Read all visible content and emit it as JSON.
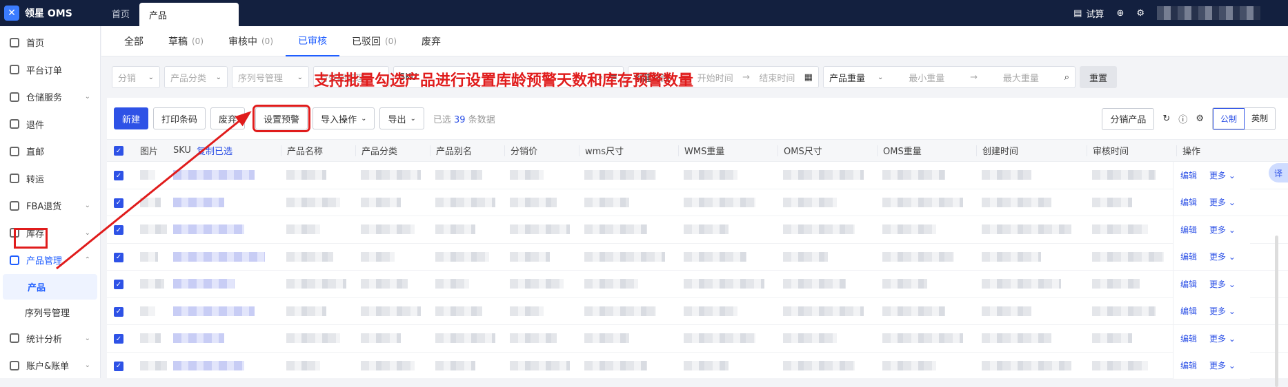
{
  "app": {
    "name": "领星 OMS"
  },
  "top_tabs": [
    {
      "label": "首页"
    },
    {
      "label": "产品"
    }
  ],
  "topbar": {
    "trial_label": "试算"
  },
  "sidebar": {
    "items": [
      {
        "label": "首页"
      },
      {
        "label": "平台订单"
      },
      {
        "label": "仓储服务"
      },
      {
        "label": "退件"
      },
      {
        "label": "直邮"
      },
      {
        "label": "转运"
      },
      {
        "label": "FBA退货"
      },
      {
        "label": "库存"
      },
      {
        "label": "产品管理"
      },
      {
        "label": "统计分析"
      },
      {
        "label": "账户&账单"
      }
    ],
    "sub_items": [
      {
        "label": "产品"
      },
      {
        "label": "序列号管理"
      }
    ]
  },
  "status_tabs": [
    {
      "label": "全部",
      "count": ""
    },
    {
      "label": "草稿",
      "count": "(0)"
    },
    {
      "label": "审核中",
      "count": "(0)"
    },
    {
      "label": "已审核",
      "count": ""
    },
    {
      "label": "已驳回",
      "count": "(0)"
    },
    {
      "label": "废弃",
      "count": ""
    }
  ],
  "filters": {
    "distribution": "分销",
    "category": "产品分类",
    "serial": "序列号管理",
    "validity": "有效期管理",
    "sku": "SKU",
    "time_field": "创建时间",
    "start": "开始时间",
    "arrow": "→",
    "end": "结束时间",
    "weight_field": "产品重量",
    "min_weight": "最小重量",
    "max_weight": "最大重量",
    "reset": "重置"
  },
  "toolbar": {
    "new": "新建",
    "print": "打印条码",
    "discard": "废弃",
    "set_alert": "设置预警",
    "import": "导入操作",
    "export": "导出",
    "selected_prefix": "已选",
    "selected_count": "39",
    "selected_suffix": "条数据",
    "distribute": "分销产品",
    "metric": "公制",
    "imperial": "英制"
  },
  "annotation": "支持批量勾选产品进行设置库龄预警天数和库存预警数量",
  "table": {
    "headers": [
      "图片",
      "SKU",
      "复制已选",
      "产品名称",
      "产品分类",
      "产品别名",
      "分销价",
      "wms尺寸",
      "WMS重量",
      "OMS尺寸",
      "OMS重量",
      "创建时间",
      "审核时间",
      "操作"
    ],
    "row_count": 8,
    "edit_label": "编辑",
    "more_label": "更多"
  },
  "float_button": "译",
  "colors": {
    "primary": "#2e52e6",
    "annotation": "#e01c1c",
    "topbar": "#13203f"
  }
}
